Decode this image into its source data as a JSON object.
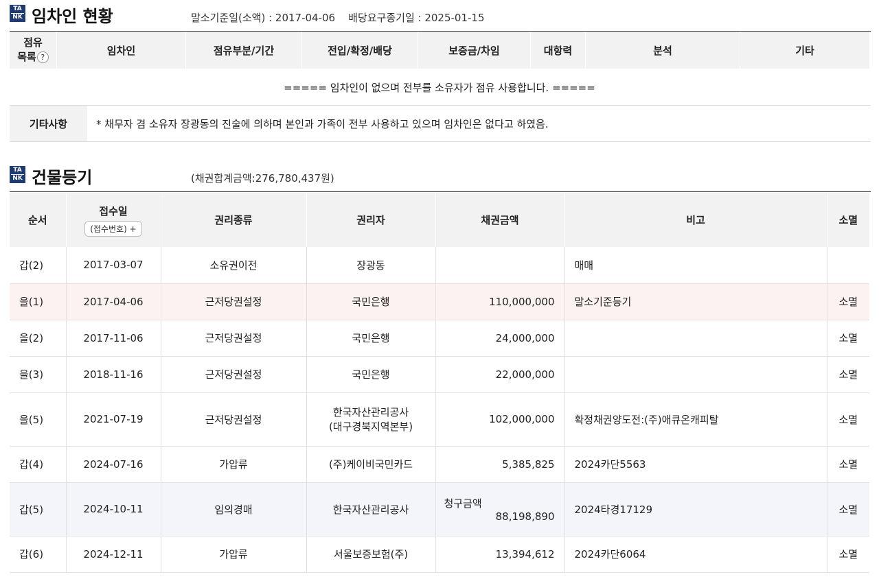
{
  "tenant_section": {
    "logo_top": "TA",
    "logo_bottom": "NK",
    "title": "임차인 현황",
    "dates": "말소기준일(소액) : 2017-04-06    배당요구종기일 : 2025-01-15",
    "headers": {
      "occupancy_line1": "점유",
      "occupancy_line2": "목록",
      "help": "?",
      "tenant": "임차인",
      "occupied_part": "점유부분/기간",
      "move_in": "전입/확정/배당",
      "deposit": "보증금/차임",
      "opposing_power": "대항력",
      "analysis": "분석",
      "other": "기타"
    },
    "notice": "===== 임차인이 없으며 전부를 소유자가 점유 사용합니다. =====",
    "etc_label": "기타사항",
    "etc_text": "* 채무자 겸 소유자 장광동의 진술에 의하며 본인과 가족이 전부 사용하고 있으며 임차인은 없다고 하였음."
  },
  "building_section": {
    "logo_top": "TA",
    "logo_bottom": "NK",
    "title": "건물등기",
    "total": "(채권합계금액:276,780,437원)",
    "headers": {
      "order": "순서",
      "received": "접수일",
      "received_btn": "(접수번호) +",
      "right_type": "권리종류",
      "holder": "권리자",
      "amount": "채권금액",
      "note": "비고",
      "extinct": "소멸"
    },
    "rows": [
      {
        "order": "갑(2)",
        "date": "2017-03-07",
        "type": "소유권이전",
        "holder": "장광동",
        "amount": "",
        "note": "매매",
        "extinct": ""
      },
      {
        "order": "을(1)",
        "date": "2017-04-06",
        "type": "근저당권설정",
        "holder": "국민은행",
        "amount": "110,000,000",
        "note": "말소기준등기",
        "extinct": "소멸"
      },
      {
        "order": "을(2)",
        "date": "2017-11-06",
        "type": "근저당권설정",
        "holder": "국민은행",
        "amount": "24,000,000",
        "note": "",
        "extinct": "소멸"
      },
      {
        "order": "을(3)",
        "date": "2018-11-16",
        "type": "근저당권설정",
        "holder": "국민은행",
        "amount": "22,000,000",
        "note": "",
        "extinct": "소멸"
      },
      {
        "order": "을(5)",
        "date": "2021-07-19",
        "type": "근저당권설정",
        "holder": "한국자산관리공사",
        "holder2": "(대구경북지역본부)",
        "amount": "102,000,000",
        "note": "확정채권양도전:(주)애큐온캐피탈",
        "extinct": "소멸"
      },
      {
        "order": "갑(4)",
        "date": "2024-07-16",
        "type": "가압류",
        "holder": "(주)케이비국민카드",
        "amount": "5,385,825",
        "note": "2024카단5563",
        "extinct": "소멸"
      },
      {
        "order": "갑(5)",
        "date": "2024-10-11",
        "type": "임의경매",
        "holder": "한국자산관리공사",
        "amount_label": "청구금액",
        "amount": "88,198,890",
        "note": "2024타경17129",
        "extinct": "소멸"
      },
      {
        "order": "갑(6)",
        "date": "2024-12-11",
        "type": "가압류",
        "holder": "서울보증보험(주)",
        "amount": "13,394,612",
        "note": "2024카단6064",
        "extinct": "소멸"
      }
    ]
  }
}
